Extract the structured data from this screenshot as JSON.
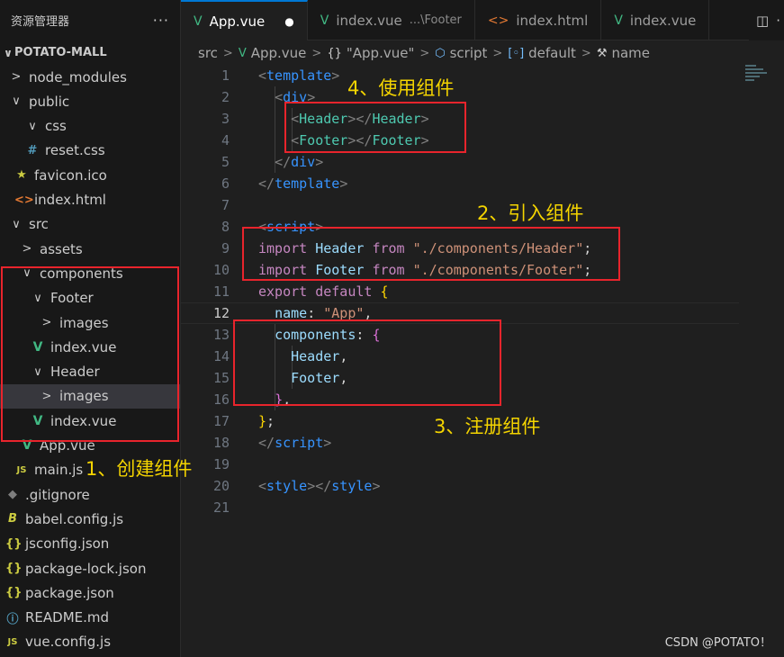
{
  "sidebar": {
    "title": "资源管理器",
    "more": "···",
    "project": "POTATO-MALL",
    "items": [
      {
        "label": "node_modules",
        "chev": ">",
        "icon": "",
        "icon_name": "folder-collapsed"
      },
      {
        "label": "public",
        "chev": "∨",
        "icon": "",
        "icon_name": "folder-expanded"
      },
      {
        "label": "css",
        "chev": "∨",
        "icon": "",
        "icon_name": "folder-expanded"
      },
      {
        "label": "reset.css",
        "chev": "",
        "icon": "#",
        "icon_name": "css-file-icon"
      },
      {
        "label": "favicon.ico",
        "chev": "",
        "icon": "★",
        "icon_name": "favicon-star-icon"
      },
      {
        "label": "index.html",
        "chev": "",
        "icon": "<>",
        "icon_name": "html-file-icon"
      },
      {
        "label": "src",
        "chev": "∨",
        "icon": "",
        "icon_name": "folder-expanded"
      },
      {
        "label": "assets",
        "chev": ">",
        "icon": "",
        "icon_name": "folder-collapsed"
      },
      {
        "label": "components",
        "chev": "∨",
        "icon": "",
        "icon_name": "folder-expanded"
      },
      {
        "label": "Footer",
        "chev": "∨",
        "icon": "",
        "icon_name": "folder-expanded"
      },
      {
        "label": "images",
        "chev": ">",
        "icon": "",
        "icon_name": "folder-collapsed"
      },
      {
        "label": "index.vue",
        "chev": "",
        "icon": "V",
        "icon_name": "vue-file-icon"
      },
      {
        "label": "Header",
        "chev": "∨",
        "icon": "",
        "icon_name": "folder-expanded"
      },
      {
        "label": "images",
        "chev": ">",
        "icon": "",
        "icon_name": "folder-collapsed"
      },
      {
        "label": "index.vue",
        "chev": "",
        "icon": "V",
        "icon_name": "vue-file-icon"
      },
      {
        "label": "App.vue",
        "chev": "",
        "icon": "V",
        "icon_name": "vue-file-icon"
      },
      {
        "label": "main.js",
        "chev": "",
        "icon": "JS",
        "icon_name": "js-file-icon"
      },
      {
        "label": ".gitignore",
        "chev": "",
        "icon": "◆",
        "icon_name": "git-file-icon"
      },
      {
        "label": "babel.config.js",
        "chev": "",
        "icon": "B",
        "icon_name": "babel-file-icon"
      },
      {
        "label": "jsconfig.json",
        "chev": "",
        "icon": "{}",
        "icon_name": "json-file-icon"
      },
      {
        "label": "package-lock.json",
        "chev": "",
        "icon": "{}",
        "icon_name": "json-file-icon"
      },
      {
        "label": "package.json",
        "chev": "",
        "icon": "{}",
        "icon_name": "json-file-icon"
      },
      {
        "label": "README.md",
        "chev": "",
        "icon": "ⓘ",
        "icon_name": "info-file-icon"
      },
      {
        "label": "vue.config.js",
        "chev": "",
        "icon": "JS",
        "icon_name": "js-file-icon"
      }
    ]
  },
  "tabs": [
    {
      "label": "App.vue",
      "icon": "V",
      "hint": "",
      "modified": "●"
    },
    {
      "label": "index.vue",
      "icon": "V",
      "hint": "...\\Footer",
      "modified": ""
    },
    {
      "label": "index.html",
      "icon": "<>",
      "hint": "",
      "modified": ""
    },
    {
      "label": "index.vue",
      "icon": "V",
      "hint": "",
      "modified": ""
    }
  ],
  "tab_actions": {
    "split": "◫",
    "more": "·"
  },
  "breadcrumbs": {
    "src": "src",
    "app": "App.vue",
    "braces": "{}",
    "app_quoted": "\"App.vue\"",
    "script": "script",
    "default": "default",
    "name": "name",
    "sep": ">"
  },
  "line_numbers": [
    "1",
    "2",
    "3",
    "4",
    "5",
    "6",
    "7",
    "8",
    "9",
    "10",
    "11",
    "12",
    "13",
    "14",
    "15",
    "16",
    "17",
    "18",
    "19",
    "20",
    "21"
  ],
  "code": {
    "l1": {
      "open": "<",
      "tag": "template",
      "close": ">"
    },
    "l2": {
      "open": "<",
      "tag": "div",
      "close": ">"
    },
    "l3": {
      "o1": "<",
      "c1": "Header",
      "g1": "></",
      "c2": "Header",
      "g2": ">"
    },
    "l4": {
      "o1": "<",
      "c1": "Footer",
      "g1": "></",
      "c2": "Footer",
      "g2": ">"
    },
    "l5": {
      "open": "</",
      "tag": "div",
      "close": ">"
    },
    "l6": {
      "open": "</",
      "tag": "template",
      "close": ">"
    },
    "l8": {
      "open": "<",
      "tag": "script",
      "close": ">"
    },
    "l9": {
      "kw": "import",
      "id": "Header",
      "from": "from",
      "str": "\"./components/Header\"",
      "end": ";"
    },
    "l10": {
      "kw": "import",
      "id": "Footer",
      "from": "from",
      "str": "\"./components/Footer\"",
      "end": ";"
    },
    "l11": {
      "kw": "export",
      "kw2": "default",
      "brace": "{"
    },
    "l12": {
      "prop": "name",
      "colon": ": ",
      "str": "\"App\"",
      "end": ","
    },
    "l13": {
      "prop": "components",
      "colon": ": ",
      "brace": "{"
    },
    "l14": {
      "id": "Header",
      "end": ","
    },
    "l15": {
      "id": "Footer",
      "end": ","
    },
    "l16": {
      "brace": "}",
      "end": ","
    },
    "l17": {
      "brace": "}",
      "end": ";"
    },
    "l18": {
      "open": "</",
      "tag": "script",
      "close": ">"
    },
    "l20": {
      "o1": "<",
      "t1": "style",
      "g1": "></",
      "t2": "style",
      "g2": ">"
    }
  },
  "annotations": {
    "use": "4、使用组件",
    "import": "2、引入组件",
    "register": "3、注册组件",
    "create": "1、创建组件"
  },
  "watermark": "CSDN @POTATO！",
  "colors": {
    "annotation_box": "#e8242c",
    "annotation_text": "#f4d400",
    "vue_icon": "#41b883",
    "active_tab_border": "#0078d4"
  }
}
